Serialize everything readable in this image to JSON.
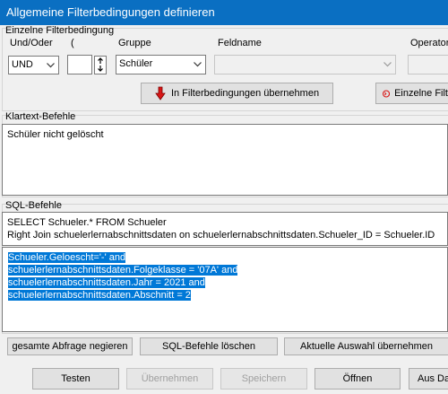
{
  "window": {
    "title": "Allgemeine Filterbedingungen definieren"
  },
  "filter_group": {
    "title": "Einzelne Filterbedingung",
    "und_oder_label": "Und/Oder",
    "und_oder_value": "UND",
    "paren_label": "(",
    "paren_value": "",
    "gruppe_label": "Gruppe",
    "gruppe_value": "Schüler",
    "feldname_label": "Feldname",
    "feldname_value": "",
    "operator_label": "Operator",
    "operator_value": "",
    "apply_label": "In Filterbedingungen übernehmen",
    "single_label": "Einzelne Filt"
  },
  "klartext": {
    "title": "Klartext-Befehle",
    "text": "Schüler nicht gelöscht"
  },
  "sql": {
    "title": "SQL-Befehle",
    "lines": [
      "SELECT Schueler.* FROM Schueler",
      "Right Join schuelerlernabschnittsdaten on schuelerlernabschnittsdaten.Schueler_ID = Schueler.ID"
    ],
    "where_lines": [
      "Schueler.Geloescht='-' and",
      "schuelerlernabschnittsdaten.Folgeklasse = '07A' and",
      "schuelerlernabschnittsdaten.Jahr = 2021 and",
      "schuelerlernabschnittsdaten.Abschnitt = 2"
    ]
  },
  "sql_actions": {
    "negate": "gesamte Abfrage negieren",
    "delete": "SQL-Befehle löschen",
    "apply_selection": "Aktuelle Auswahl übernehmen"
  },
  "footer": {
    "testen": "Testen",
    "uebernehmen": "Übernehmen",
    "speichern": "Speichern",
    "oeffnen": "Öffnen",
    "aus_da": "Aus Da"
  },
  "colors": {
    "titlebar": "#0a6fc2",
    "selection": "#0078d7",
    "arrow_red": "#d91616"
  },
  "icons": {
    "apply": "red-down-arrow-icon",
    "single": "red-circle-icon",
    "spinner": "up-down-arrow-icon"
  }
}
